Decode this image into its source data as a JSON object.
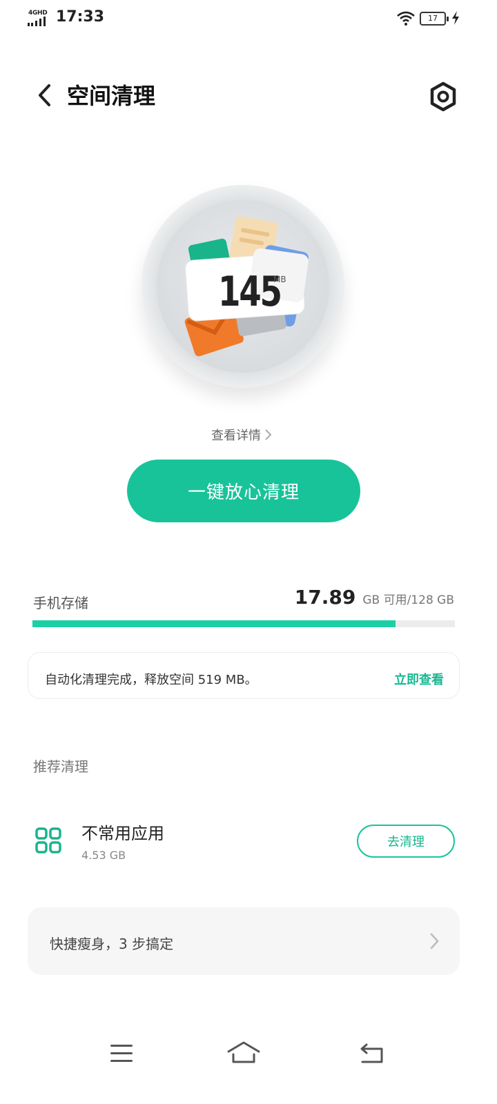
{
  "status_bar": {
    "network": "4GHD",
    "time": "17:33",
    "battery": "17"
  },
  "header": {
    "title": "空间清理",
    "back_icon": "chevron-left-icon",
    "settings_icon": "gear-hexagon-icon"
  },
  "cleanup": {
    "value": "145",
    "unit": "MB",
    "detail_link": "查看详情",
    "clean_button": "一键放心清理"
  },
  "storage": {
    "label": "手机存储",
    "available": "17.89",
    "suffix": "GB 可用/128 GB",
    "used_fraction": 0.86,
    "bar_color": "#1ccfa5"
  },
  "notice": {
    "text": "自动化清理完成，释放空间 519 MB。",
    "link": "立即查看"
  },
  "recommend": {
    "section_title": "推荐清理",
    "items": [
      {
        "title": "不常用应用",
        "size": "4.53 GB",
        "button": "去清理",
        "icon": "apps-grid-icon"
      }
    ]
  },
  "quick": {
    "text": "快捷瘦身，3 步搞定"
  },
  "nav": {
    "menu_icon": "menu-icon",
    "home_icon": "home-icon",
    "back_icon": "back-icon"
  },
  "colors": {
    "accent": "#19c39a",
    "accent_text": "#18b892"
  }
}
